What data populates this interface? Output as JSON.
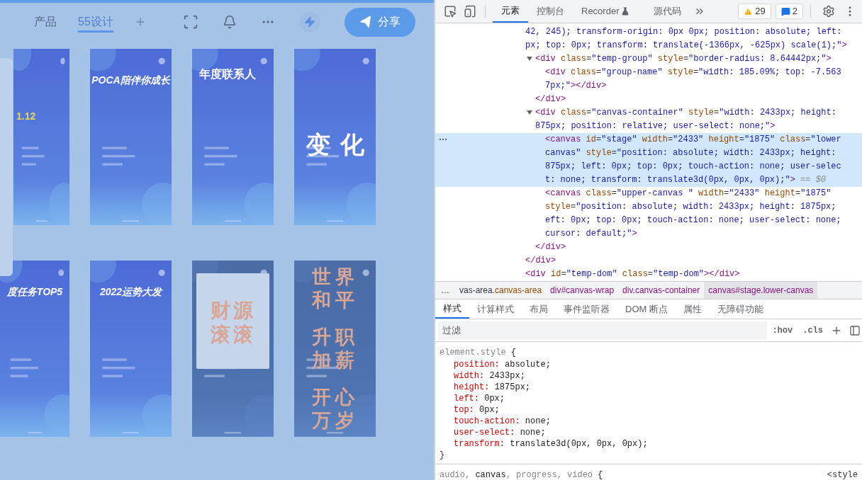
{
  "canvas_app": {
    "tabs": [
      {
        "label": "产品",
        "selected": false
      },
      {
        "label": "55设计",
        "selected": true
      }
    ],
    "share_button": "分享",
    "poster_rows": [
      [
        {
          "kind": "number",
          "title_lines": [
            "1.12"
          ]
        },
        {
          "kind": "top",
          "title_lines": [
            "POCA陪伴你成长"
          ]
        },
        {
          "kind": "label",
          "title_lines": [
            "年度联系人"
          ]
        },
        {
          "kind": "center",
          "title_lines": [
            "变化"
          ]
        }
      ],
      [
        {
          "kind": "top",
          "title_lines": [
            "度任务TOP5"
          ]
        },
        {
          "kind": "top",
          "title_lines": [
            "2022运势大发"
          ]
        },
        {
          "kind": "card",
          "title_lines": [
            "财源",
            "滚滚"
          ]
        },
        {
          "kind": "stack",
          "title_lines": [
            "世界",
            "和平",
            "升职",
            "加薪",
            "开心",
            "万岁"
          ]
        }
      ]
    ]
  },
  "devtools": {
    "tabs": [
      {
        "label": "元素",
        "selected": true,
        "kind": "text"
      },
      {
        "label": "控制台",
        "selected": false,
        "kind": "text"
      },
      {
        "label": "Recorder",
        "selected": false,
        "kind": "flask"
      },
      {
        "label": "源代码",
        "selected": false,
        "kind": "text"
      }
    ],
    "badges": [
      {
        "kind": "warning",
        "count": "29"
      },
      {
        "kind": "message",
        "count": "2"
      }
    ],
    "dom_tree": [
      {
        "selected": false,
        "lines": [
          [
            {
              "kind": "value",
              "text": "42, 245); transform-origin: 0px 0px; position: absolute; left:"
            }
          ],
          [
            {
              "kind": "value",
              "text": "px; top: 0px; transform: translate(-1366px, -625px) scale(1);\""
            },
            {
              "kind": "tag",
              "text": ">"
            }
          ]
        ],
        "children": [
          {
            "expanded": true,
            "selected": false,
            "lines": [
              [
                {
                  "kind": "tag",
                  "text": "<div"
                },
                {
                  "kind": "attr",
                  "text": " class"
                },
                {
                  "kind": "punct",
                  "text": "="
                },
                {
                  "kind": "value",
                  "text": "\"temp-group\""
                },
                {
                  "kind": "attr",
                  "text": " style"
                },
                {
                  "kind": "punct",
                  "text": "="
                },
                {
                  "kind": "value",
                  "text": "\"border-radius: 8.64442px;\""
                },
                {
                  "kind": "tag",
                  "text": ">"
                }
              ]
            ],
            "children": [
              {
                "selected": false,
                "lines": [
                  [
                    {
                      "kind": "tag",
                      "text": "<div"
                    },
                    {
                      "kind": "attr",
                      "text": " class"
                    },
                    {
                      "kind": "punct",
                      "text": "="
                    },
                    {
                      "kind": "value",
                      "text": "\"group-name\""
                    },
                    {
                      "kind": "attr",
                      "text": " style"
                    },
                    {
                      "kind": "punct",
                      "text": "="
                    },
                    {
                      "kind": "value",
                      "text": "\"width: 185.09%; top: -7.563"
                    }
                  ],
                  [
                    {
                      "kind": "value",
                      "text": "7px;\""
                    },
                    {
                      "kind": "tag",
                      "text": "></div>"
                    }
                  ]
                ]
              }
            ],
            "close": [
              {
                "kind": "tag",
                "text": "</div>"
              }
            ]
          },
          {
            "expanded": true,
            "selected": false,
            "lines": [
              [
                {
                  "kind": "tag",
                  "text": "<div"
                },
                {
                  "kind": "attr",
                  "text": " class"
                },
                {
                  "kind": "punct",
                  "text": "="
                },
                {
                  "kind": "value",
                  "text": "\"canvas-container\""
                },
                {
                  "kind": "attr",
                  "text": " style"
                },
                {
                  "kind": "punct",
                  "text": "="
                },
                {
                  "kind": "value",
                  "text": "\"width: 2433px; height:"
                }
              ],
              [
                {
                  "kind": "value",
                  "text": "875px; position: relative; user-select: none;\""
                },
                {
                  "kind": "tag",
                  "text": ">"
                }
              ]
            ],
            "children": [
              {
                "selected": true,
                "lines": [
                  [
                    {
                      "kind": "tag",
                      "text": "<canvas"
                    },
                    {
                      "kind": "attr",
                      "text": " id"
                    },
                    {
                      "kind": "punct",
                      "text": "="
                    },
                    {
                      "kind": "value",
                      "text": "\"stage\""
                    },
                    {
                      "kind": "attr",
                      "text": " width"
                    },
                    {
                      "kind": "punct",
                      "text": "="
                    },
                    {
                      "kind": "value",
                      "text": "\"2433\""
                    },
                    {
                      "kind": "attr",
                      "text": " height"
                    },
                    {
                      "kind": "punct",
                      "text": "="
                    },
                    {
                      "kind": "value",
                      "text": "\"1875\""
                    },
                    {
                      "kind": "attr",
                      "text": " class"
                    },
                    {
                      "kind": "punct",
                      "text": "="
                    },
                    {
                      "kind": "value",
                      "text": "\"lower"
                    }
                  ],
                  [
                    {
                      "kind": "value",
                      "text": "canvas\""
                    },
                    {
                      "kind": "attr",
                      "text": " style"
                    },
                    {
                      "kind": "punct",
                      "text": "="
                    },
                    {
                      "kind": "value",
                      "text": "\"position: absolute; width: 2433px; height:"
                    }
                  ],
                  [
                    {
                      "kind": "value",
                      "text": "875px; left: 0px; top: 0px; touch-action: none; user-selec"
                    }
                  ],
                  [
                    {
                      "kind": "value",
                      "text": "t: none; transform: translate3d(0px, 0px, 0px);\""
                    },
                    {
                      "kind": "tag",
                      "text": ">"
                    },
                    {
                      "kind": "comment",
                      "text": " == $0"
                    }
                  ]
                ]
              },
              {
                "selected": false,
                "lines": [
                  [
                    {
                      "kind": "tag",
                      "text": "<canvas"
                    },
                    {
                      "kind": "attr",
                      "text": " class"
                    },
                    {
                      "kind": "punct",
                      "text": "="
                    },
                    {
                      "kind": "value",
                      "text": "\"upper-canvas \""
                    },
                    {
                      "kind": "attr",
                      "text": " width"
                    },
                    {
                      "kind": "punct",
                      "text": "="
                    },
                    {
                      "kind": "value",
                      "text": "\"2433\""
                    },
                    {
                      "kind": "attr",
                      "text": " height"
                    },
                    {
                      "kind": "punct",
                      "text": "="
                    },
                    {
                      "kind": "value",
                      "text": "\"1875\""
                    }
                  ],
                  [
                    {
                      "kind": "attr",
                      "text": "style"
                    },
                    {
                      "kind": "punct",
                      "text": "="
                    },
                    {
                      "kind": "value",
                      "text": "\"position: absolute; width: 2433px; height: 1875px;"
                    }
                  ],
                  [
                    {
                      "kind": "value",
                      "text": "eft: 0px; top: 0px; touch-action: none; user-select: none;"
                    }
                  ],
                  [
                    {
                      "kind": "value",
                      "text": "cursor: default;\""
                    },
                    {
                      "kind": "tag",
                      "text": ">"
                    }
                  ]
                ]
              }
            ],
            "close": [
              {
                "kind": "tag",
                "text": "</div>"
              }
            ]
          }
        ],
        "close": [
          {
            "kind": "tag",
            "text": "</div>"
          }
        ]
      },
      {
        "selected": false,
        "lines": [
          [
            {
              "kind": "tag",
              "text": "<div"
            },
            {
              "kind": "attr",
              "text": " id"
            },
            {
              "kind": "punct",
              "text": "="
            },
            {
              "kind": "value",
              "text": "\"temp-dom\""
            },
            {
              "kind": "attr",
              "text": " class"
            },
            {
              "kind": "punct",
              "text": "="
            },
            {
              "kind": "value",
              "text": "\"temp-dom\""
            },
            {
              "kind": "tag",
              "text": "></div>"
            }
          ]
        ]
      }
    ],
    "breadcrumb_more": "…",
    "breadcrumbs": [
      {
        "tag": "vas-area",
        "rest": ".canvas-area",
        "selected": false
      },
      {
        "tag": "div",
        "rest": "#canvas-wrap",
        "selected": false
      },
      {
        "tag": "div",
        "rest": ".canvas-container",
        "selected": false
      },
      {
        "tag": "canvas",
        "rest": "#stage.lower-canvas",
        "selected": true
      }
    ],
    "pane_tabs": [
      {
        "label": "样式",
        "selected": true
      },
      {
        "label": "计算样式",
        "selected": false
      },
      {
        "label": "布局",
        "selected": false
      },
      {
        "label": "事件监听器",
        "selected": false
      },
      {
        "label": "DOM 断点",
        "selected": false
      },
      {
        "label": "属性",
        "selected": false
      },
      {
        "label": "无障碍功能",
        "selected": false
      }
    ],
    "filter": {
      "placeholder": "过滤"
    },
    "filter_buttons": [
      ":hov",
      ".cls"
    ],
    "rules": [
      {
        "selector": [
          {
            "text": "element.style",
            "matched": false
          }
        ],
        "open": "{",
        "declarations": [
          {
            "property": "position:",
            "value": "absolute;"
          },
          {
            "property": "width:",
            "value": "2433px;"
          },
          {
            "property": "height:",
            "value": "1875px;"
          },
          {
            "property": "left:",
            "value": "0px;"
          },
          {
            "property": "top:",
            "value": "0px;"
          },
          {
            "property": "touch-action:",
            "value": "none;"
          },
          {
            "property": "user-select:",
            "value": "none;"
          },
          {
            "property": "transform:",
            "value": "translate3d(0px, 0px, 0px);"
          }
        ],
        "close": "}"
      },
      {
        "selector": [
          {
            "text": "audio, ",
            "matched": false
          },
          {
            "text": "canvas",
            "matched": true
          },
          {
            "text": ", progress, video",
            "matched": false
          }
        ],
        "open": "{",
        "source": "<style"
      }
    ]
  }
}
